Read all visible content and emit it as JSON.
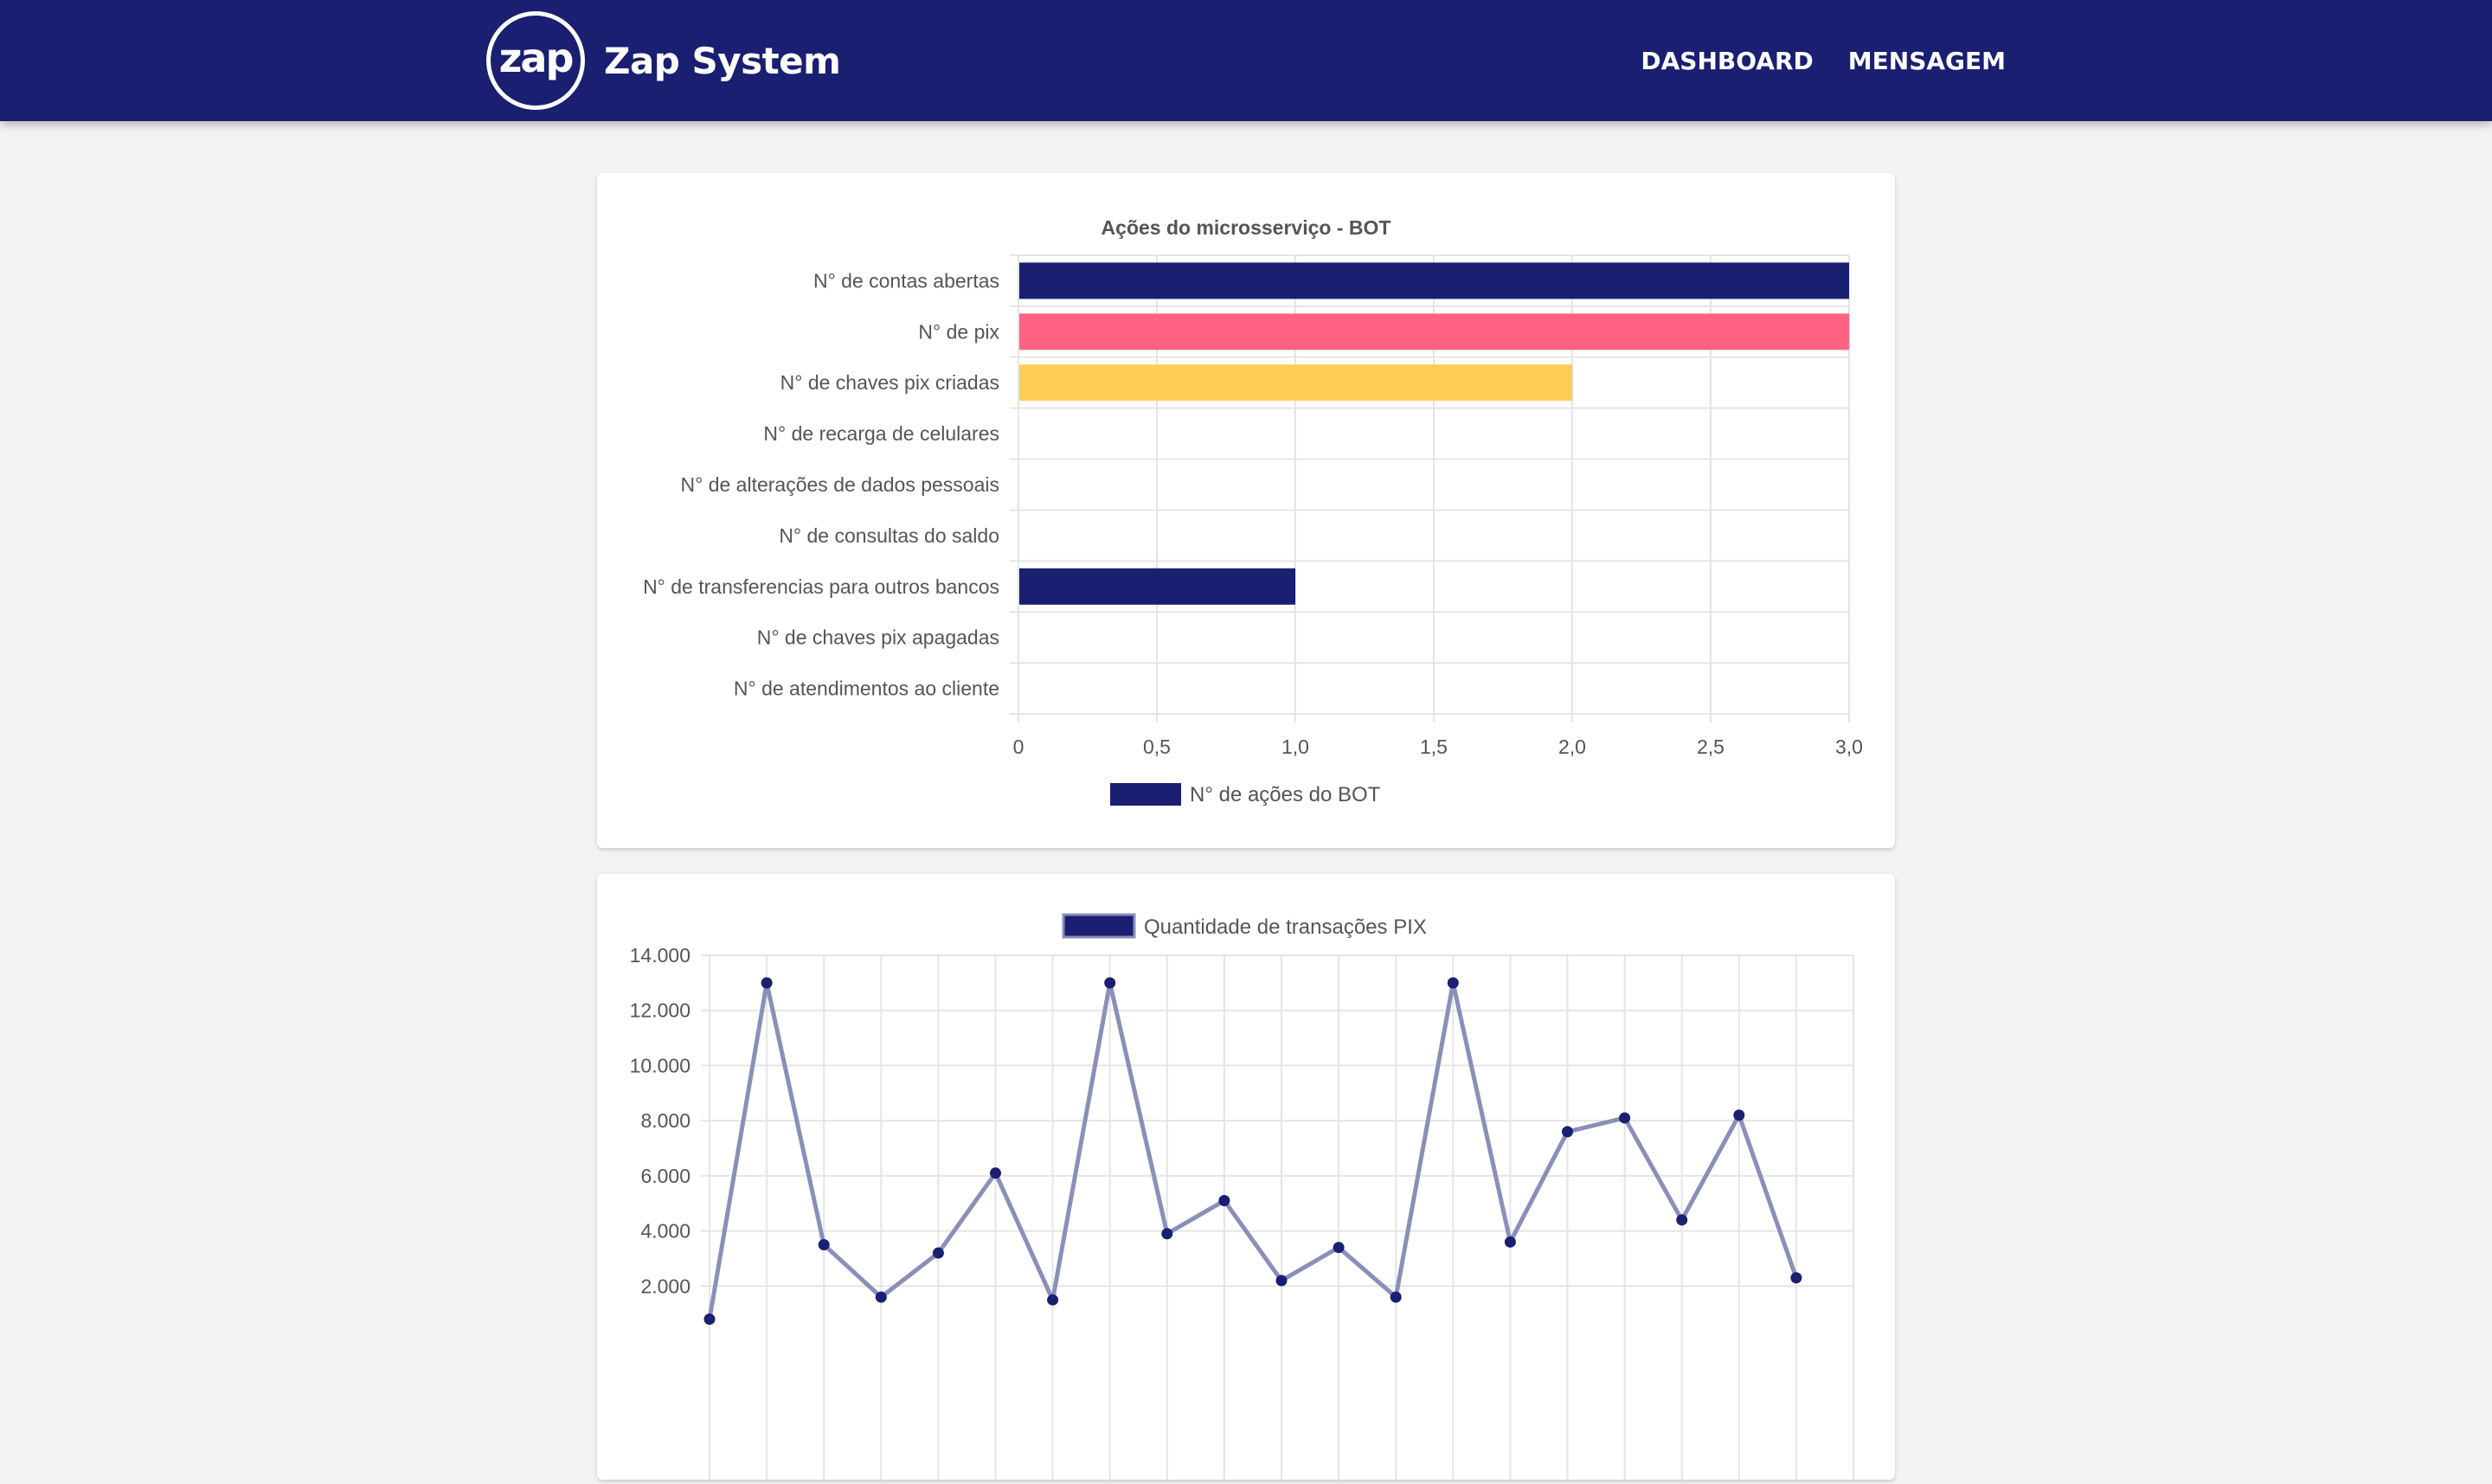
{
  "navbar": {
    "logo_text": "zap",
    "title": "Zap System",
    "links": [
      "DASHBOARD",
      "MENSAGEM"
    ],
    "background": "#1a1f71"
  },
  "chart_data": [
    {
      "type": "bar",
      "orientation": "horizontal",
      "title": "Ações do microsserviço - BOT",
      "categories": [
        "N° de contas abertas",
        "N° de pix",
        "N° de chaves pix criadas",
        "N° de recarga de celulares",
        "N° de alterações de dados pessoais",
        "N° de consultas do saldo",
        "N° de transferencias para outros bancos",
        "N° de chaves pix apagadas",
        "N° de atendimentos ao cliente"
      ],
      "values": [
        3,
        3,
        2,
        0,
        0,
        0,
        1,
        0,
        0
      ],
      "colors": [
        "#1a1f71",
        "#ff6384",
        "#ffcd56",
        "#1a1f71",
        "#1a1f71",
        "#1a1f71",
        "#1a1f71",
        "#1a1f71",
        "#1a1f71"
      ],
      "xlim": [
        0,
        3
      ],
      "xticks": [
        "0",
        "0,5",
        "1,0",
        "1,5",
        "2,0",
        "2,5",
        "3,0"
      ],
      "legend": "N° de ações do BOT",
      "legend_color": "#1a1f71",
      "legend_position": "bottom",
      "grid": true
    },
    {
      "type": "line",
      "legend": "Quantidade de transações PIX",
      "legend_position": "top",
      "line_color": "#8a8fba",
      "point_color": "#1a1f71",
      "ylim": [
        0,
        14000
      ],
      "yticks": [
        "14.000",
        "12.000",
        "10.000",
        "8.000",
        "6.000",
        "4.000",
        "2.000"
      ],
      "values": [
        800,
        13000,
        3500,
        1600,
        3200,
        6100,
        1500,
        13000,
        3900,
        5100,
        2200,
        3400,
        1600,
        13000,
        3600,
        7600,
        8100,
        4400,
        8200,
        2300
      ],
      "grid": true
    }
  ]
}
